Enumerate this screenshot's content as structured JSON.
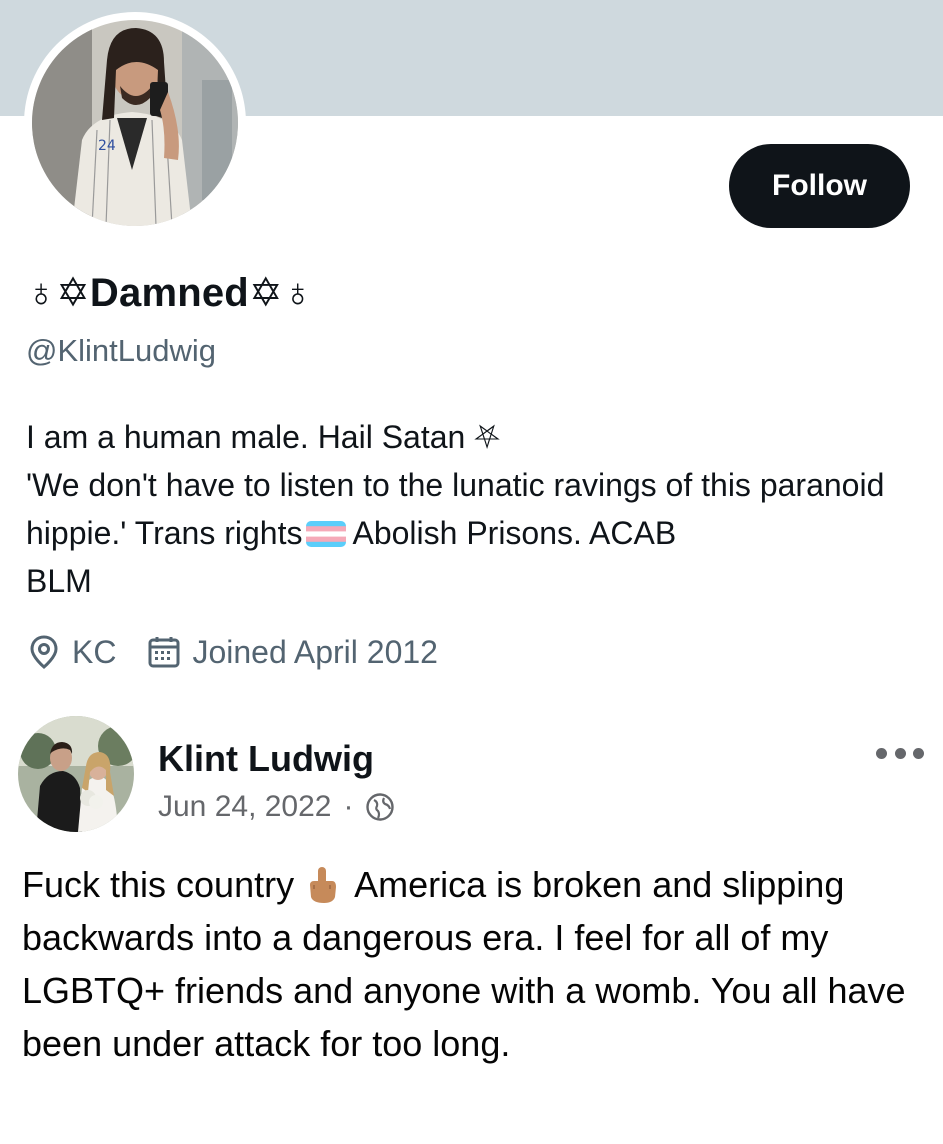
{
  "profile": {
    "display_name": "ᕱ✡Damned✡ᕱ",
    "name_symbol_left": "♁✡",
    "name_text": "Damned",
    "name_symbol_right": "✡♁",
    "handle": "@KlintLudwig",
    "follow_label": "Follow",
    "bio_line1": "I am a human male. Hail Satan ⛧",
    "bio_line2_part1": "'We don't have to listen to the lunatic ravings of this paranoid hippie.' Trans rights",
    "bio_line2_part2": "Abolish Prisons. ACAB",
    "bio_line3": "BLM",
    "location": "KC",
    "joined": "Joined April 2012"
  },
  "post": {
    "author": "Klint Ludwig",
    "date": "Jun 24, 2022",
    "separator": "·",
    "text_part1": "Fuck this country",
    "text_part2": "America is broken and slipping backwards into a dangerous era. I feel for all of my LGBTQ+ friends and anyone with a womb. You all have been under attack for too long."
  },
  "icons": {
    "location": "location-pin-icon",
    "calendar": "calendar-icon",
    "globe": "globe-icon",
    "more": "more-dots-icon",
    "flag": "trans-flag-emoji",
    "finger": "middle-finger-emoji"
  },
  "colors": {
    "banner": "#cfd9de",
    "button_bg": "#0f1419",
    "secondary_text": "#536471",
    "flag_blue": "#5bcefa",
    "flag_pink": "#f5a9b8"
  }
}
